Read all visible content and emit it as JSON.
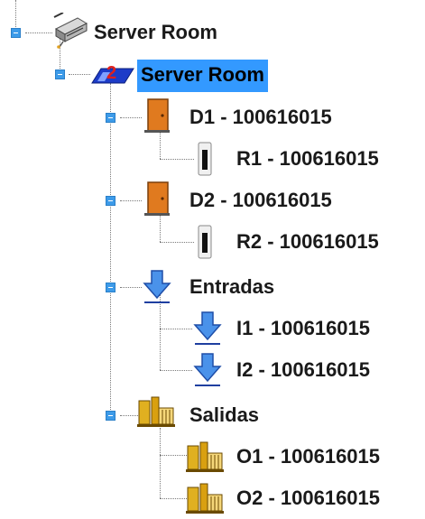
{
  "tree": {
    "root": {
      "label": "Server Room",
      "icon": "server-icon"
    },
    "site": {
      "label": "Server Room",
      "badge": "2",
      "icon": "site-badge-icon",
      "selected": true
    },
    "doors": [
      {
        "label": "D1 - 100616015",
        "icon": "door-icon",
        "reader": {
          "label": "R1 - 100616015",
          "icon": "card-reader-icon"
        }
      },
      {
        "label": "D2 - 100616015",
        "icon": "door-icon",
        "reader": {
          "label": "R2 - 100616015",
          "icon": "card-reader-icon"
        }
      }
    ],
    "inputs": {
      "label": "Entradas",
      "icon": "download-arrow-icon",
      "items": [
        {
          "label": "I1 - 100616015",
          "icon": "download-arrow-icon"
        },
        {
          "label": "I2 - 100616015",
          "icon": "download-arrow-icon"
        }
      ]
    },
    "outputs": {
      "label": "Salidas",
      "icon": "relay-icon",
      "items": [
        {
          "label": "O1 - 100616015",
          "icon": "relay-icon"
        },
        {
          "label": "O2 - 100616015",
          "icon": "relay-icon"
        }
      ]
    }
  },
  "colors": {
    "selection": "#3399ff",
    "toggle": "#3d9be9",
    "door": "#e07a1f",
    "arrow": "#2f7fe0"
  }
}
